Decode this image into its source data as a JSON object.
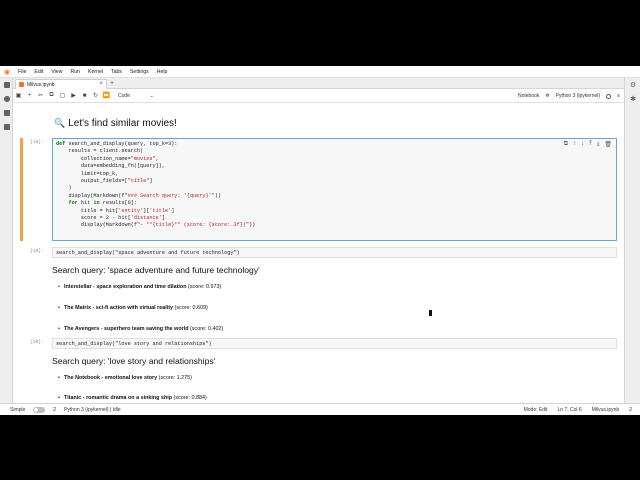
{
  "menubar": {
    "items": [
      "File",
      "Edit",
      "View",
      "Run",
      "Kernel",
      "Tabs",
      "Settings",
      "Help"
    ]
  },
  "tab": {
    "title": "Milvus.ipynb",
    "close": "×",
    "add": "+"
  },
  "toolbar": {
    "cell_type": "Code",
    "notebook_label": "Notebook",
    "kernel_label": "Python 3 (ipykernel)"
  },
  "notebook": {
    "heading_icon": "🔍",
    "heading": "Let's find similar movies!",
    "cells": [
      {
        "prompt": "[18]:",
        "code": [
          "def search_and_display(query, top_k=3):",
          "    results = client.search(",
          "        collection_name=\"movies\",",
          "        data=embedding_fn([query]),",
          "        limit=top_k,",
          "        output_fields=[\"title\"]",
          "    )",
          "    display(Markdown(f\"### Search query: '{query}'\"))",
          "    for hit in results[0]:",
          "        title = hit['entity']['title']",
          "        score = 2 - hit['distance']",
          "        display(Markdown(f\"- **{title}** (score: {score:.3f})\"))"
        ]
      },
      {
        "prompt": "[19]:",
        "code": "search_and_display(\"space adventure and future technology\")",
        "output_title": "Search query: 'space adventure and future technology'",
        "results": [
          {
            "title": "Interstellar - space exploration and time dilation",
            "score": "(score: 0.973)"
          },
          {
            "title": "The Matrix - sci-fi action with virtual reality",
            "score": "(score: 0.609)"
          },
          {
            "title": "The Avengers - superhero team saving the world",
            "score": "(score: 0.402)"
          }
        ]
      },
      {
        "prompt": "[20]:",
        "code": "search_and_display(\"love story and relationships\")",
        "output_title": "Search query: 'love story and relationships'",
        "results": [
          {
            "title": "The Notebook - emotional love story",
            "score": "(score: 1.275)"
          },
          {
            "title": "Titanic - romantic drama on a sinking ship",
            "score": "(score: 0.884)"
          }
        ]
      }
    ]
  },
  "statusbar": {
    "mode_label": "Simple",
    "count1": "2",
    "kernel_status": "Python 3 (ipykernel) | Idle",
    "mode": "Mode: Edit",
    "position": "Ln 7, Col 6",
    "file": "Milvus.ipynb",
    "count2": "2"
  }
}
